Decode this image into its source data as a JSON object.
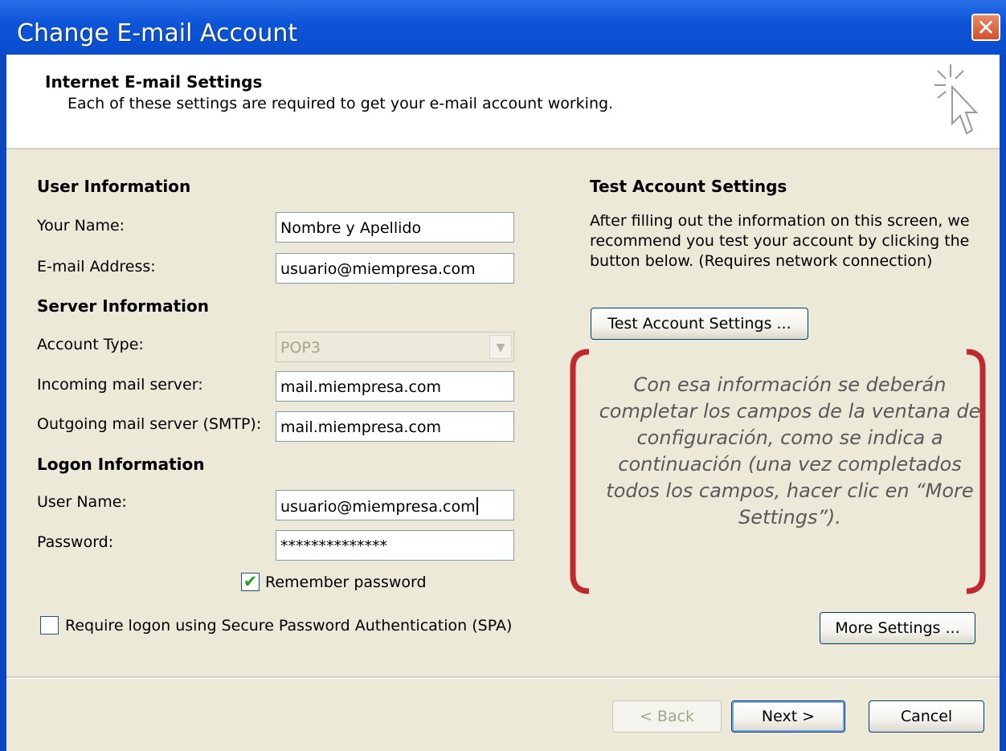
{
  "window": {
    "title": "Change E-mail Account",
    "close_glyph": "✕"
  },
  "header": {
    "title": "Internet E-mail Settings",
    "subtitle": "Each of these settings are required to get your e-mail account working.",
    "icon": "cursor-sparkle-icon"
  },
  "user_info": {
    "heading": "User Information",
    "your_name_label": "Your Name:",
    "your_name_value": "Nombre y Apellido",
    "email_label": "E-mail Address:",
    "email_value": "usuario@miempresa.com"
  },
  "server_info": {
    "heading": "Server Information",
    "account_type_label": "Account Type:",
    "account_type_value": "POP3",
    "incoming_label": "Incoming mail server:",
    "incoming_value": "mail.miempresa.com",
    "outgoing_label": "Outgoing mail server (SMTP):",
    "outgoing_value": "mail.miempresa.com"
  },
  "logon_info": {
    "heading": "Logon Information",
    "username_label": "User Name:",
    "username_value": "usuario@miempresa.com",
    "password_label": "Password:",
    "password_value": "**************",
    "remember_label": "Remember password",
    "remember_checked": true,
    "spa_label": "Require logon using Secure Password Authentication (SPA)",
    "spa_checked": false
  },
  "test": {
    "heading": "Test Account Settings",
    "description": "After filling out the information on this screen, we recommend you test your account by clicking the button below. (Requires network connection)",
    "button_label": "Test Account Settings ..."
  },
  "annotation": {
    "text": "Con esa información se deberán completar los campos de la ventana de configuración, como se indica a continuación (una vez completados todos los campos, hacer clic en “More Settings”).",
    "bracket_color": "#c0282e"
  },
  "more_settings_label": "More Settings ...",
  "footer": {
    "back_label": "< Back",
    "next_label": "Next >",
    "cancel_label": "Cancel"
  },
  "colors": {
    "titlebar": "#0a4fd0",
    "dialog_bg": "#ece9d8",
    "close_button": "#d4502c",
    "check": "#21a121"
  }
}
